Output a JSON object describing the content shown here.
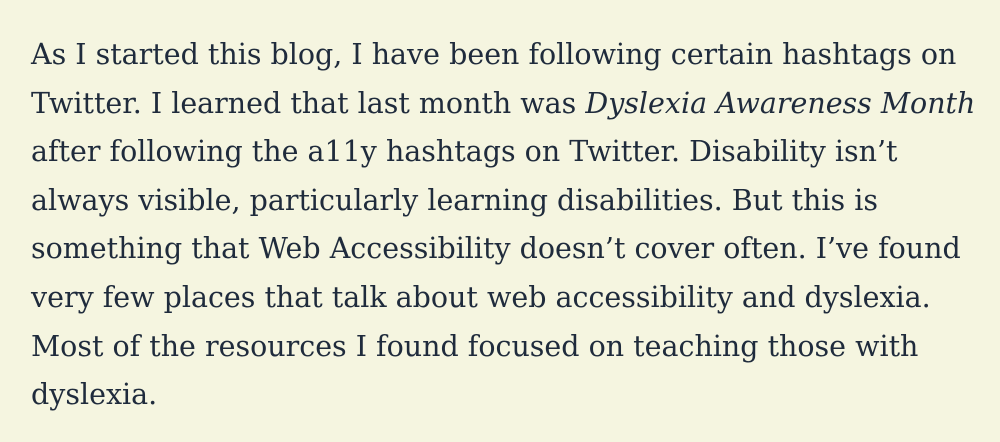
{
  "paragraph": {
    "line1": "As I started this blog, I have been following certain hashtags on",
    "line2_before": "Twitter. I learned that last month was ",
    "line2_emphasis": "Dyslexia Awareness Month",
    "line3": "after following the a11y hashtags on Twitter. Disability isn’t",
    "line4": "always visible, particularly learning disabilities. But this is",
    "line5": "something that Web Accessibility doesn’t cover often. I’ve found",
    "line6": "very few places that talk about web accessibility and dyslexia.",
    "line7": "Most of the resources I found focused on teaching those with",
    "line8": "dyslexia."
  },
  "colors": {
    "background": "#f5f5e0",
    "text": "#1f2b3c"
  }
}
